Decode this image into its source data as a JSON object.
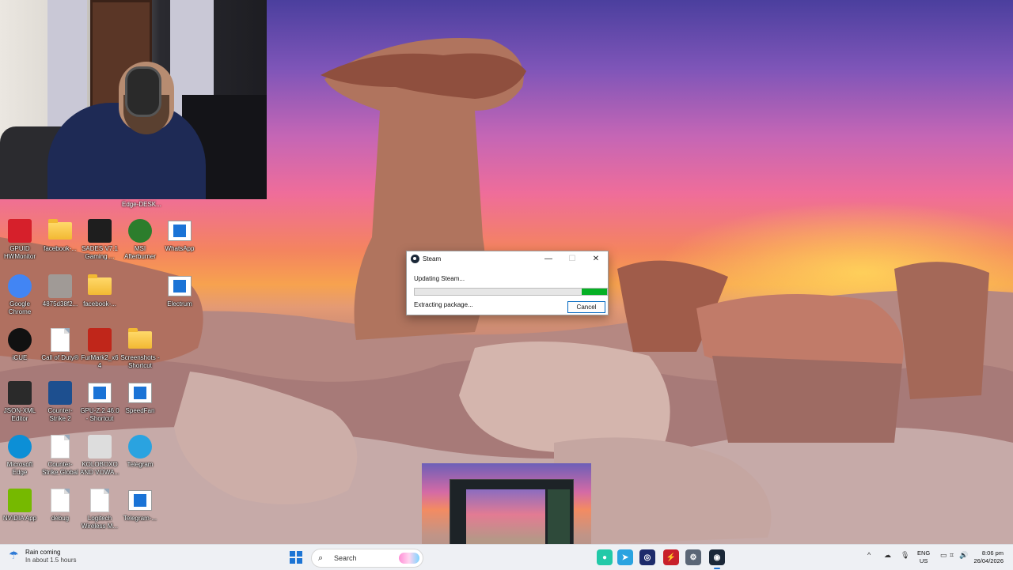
{
  "webcam": {
    "caption": "Edge-DESK..."
  },
  "desktop_icons": [
    {
      "id": "gpuid",
      "label": "GPUID HWMonitor",
      "icon": "hwmonitor-icon",
      "color": "#d6202b"
    },
    {
      "id": "facebook1",
      "label": "facebook-...",
      "icon": "folder-icon",
      "color": "#f2b933"
    },
    {
      "id": "sadesv",
      "label": "SADES V7.1 Gaming ...",
      "icon": "sades-icon",
      "color": "#1e1e1e"
    },
    {
      "id": "msi",
      "label": "MSI Afterburner",
      "icon": "msi-afterburner-icon",
      "color": "#2c7d2c"
    },
    {
      "id": "whatsapp",
      "label": "WhatsApp",
      "icon": "app-window-icon",
      "color": "#1a73d6"
    },
    {
      "id": "chrome",
      "label": "Google Chrome",
      "icon": "chrome-icon",
      "color": "#4285f4"
    },
    {
      "id": "file487",
      "label": "4875d38f2...",
      "icon": "image-file-icon",
      "color": "#a09a96"
    },
    {
      "id": "facebook2",
      "label": "facebook-...",
      "icon": "folder-icon",
      "color": "#f2b933"
    },
    {
      "id": "electrum",
      "label": "Electrum",
      "icon": "app-window-icon",
      "color": "#1a73d6"
    },
    {
      "id": "icue",
      "label": "iCUE",
      "icon": "icue-icon",
      "color": "#111111"
    },
    {
      "id": "cod",
      "label": "Call of Duty®",
      "icon": "document-icon",
      "color": "#ffffff"
    },
    {
      "id": "furmark",
      "label": "FurMark2_x64",
      "icon": "furmark-icon",
      "color": "#c0261a"
    },
    {
      "id": "screenshots",
      "label": "Screenshots - Shortcut",
      "icon": "folder-icon",
      "color": "#f2b933"
    },
    {
      "id": "jsonxml",
      "label": "JSON-XML Editor",
      "icon": "json-xml-icon",
      "color": "#2a2a2a"
    },
    {
      "id": "cs2",
      "label": "Counter-Strike 2",
      "icon": "counter-strike-icon",
      "color": "#1d4f8f"
    },
    {
      "id": "gpuz",
      "label": "GPU-Z.2.46.0 - Shortcut",
      "icon": "app-window-icon",
      "color": "#1a73d6"
    },
    {
      "id": "speedfan",
      "label": "SpeedFan",
      "icon": "app-window-icon",
      "color": "#1a73d6"
    },
    {
      "id": "edge",
      "label": "Microsoft Edge",
      "icon": "edge-icon",
      "color": "#0c8fd6"
    },
    {
      "id": "csgo",
      "label": "Counter-Strike Global Offe...",
      "icon": "document-icon",
      "color": "#ffffff"
    },
    {
      "id": "koloboxo",
      "label": "KOLOBOXO AND VOWA...",
      "icon": "image-file-icon",
      "color": "#dddddd"
    },
    {
      "id": "telegram",
      "label": "Telegram",
      "icon": "telegram-icon",
      "color": "#2aa3e0"
    },
    {
      "id": "nvidia",
      "label": "NVIDIA App",
      "icon": "nvidia-icon",
      "color": "#76b900"
    },
    {
      "id": "debug",
      "label": "debug",
      "icon": "document-icon",
      "color": "#ffffff"
    },
    {
      "id": "logitech",
      "label": "Logitech Wireless M...",
      "icon": "document-icon",
      "color": "#ffffff"
    },
    {
      "id": "telegram2",
      "label": "Telegram-...",
      "icon": "app-window-icon",
      "color": "#1a73d6"
    }
  ],
  "steam_dialog": {
    "title": "Steam",
    "minimize_label": "—",
    "maximize_label": "☐",
    "close_label": "✕",
    "status": "Updating Steam...",
    "progress": 0.13,
    "substatus": "Extracting package...",
    "cancel_label": "Cancel",
    "progress_color": "#06b025"
  },
  "taskbar": {
    "weather_title": "Rain coming",
    "weather_sub": "In about 1.5 hours",
    "search_placeholder": "Search",
    "apps": [
      {
        "name": "chat-app-icon",
        "color": "#22c9a8",
        "glyph": "●"
      },
      {
        "name": "telegram-icon",
        "color": "#2aa3e0",
        "glyph": "➤"
      },
      {
        "name": "icue-icon",
        "color": "#1d2b6b",
        "glyph": "◎"
      },
      {
        "name": "hwmonitor-icon",
        "color": "#c8202b",
        "glyph": "⚡"
      },
      {
        "name": "settings-gear-icon",
        "color": "#5b6676",
        "glyph": "⚙"
      },
      {
        "name": "steam-icon",
        "color": "#1b2838",
        "glyph": "◉"
      }
    ],
    "tray_chevron": "^",
    "lang_line1": "ENG",
    "lang_line2": "US",
    "time": "8:06 pm",
    "date": "26/04/2026"
  }
}
